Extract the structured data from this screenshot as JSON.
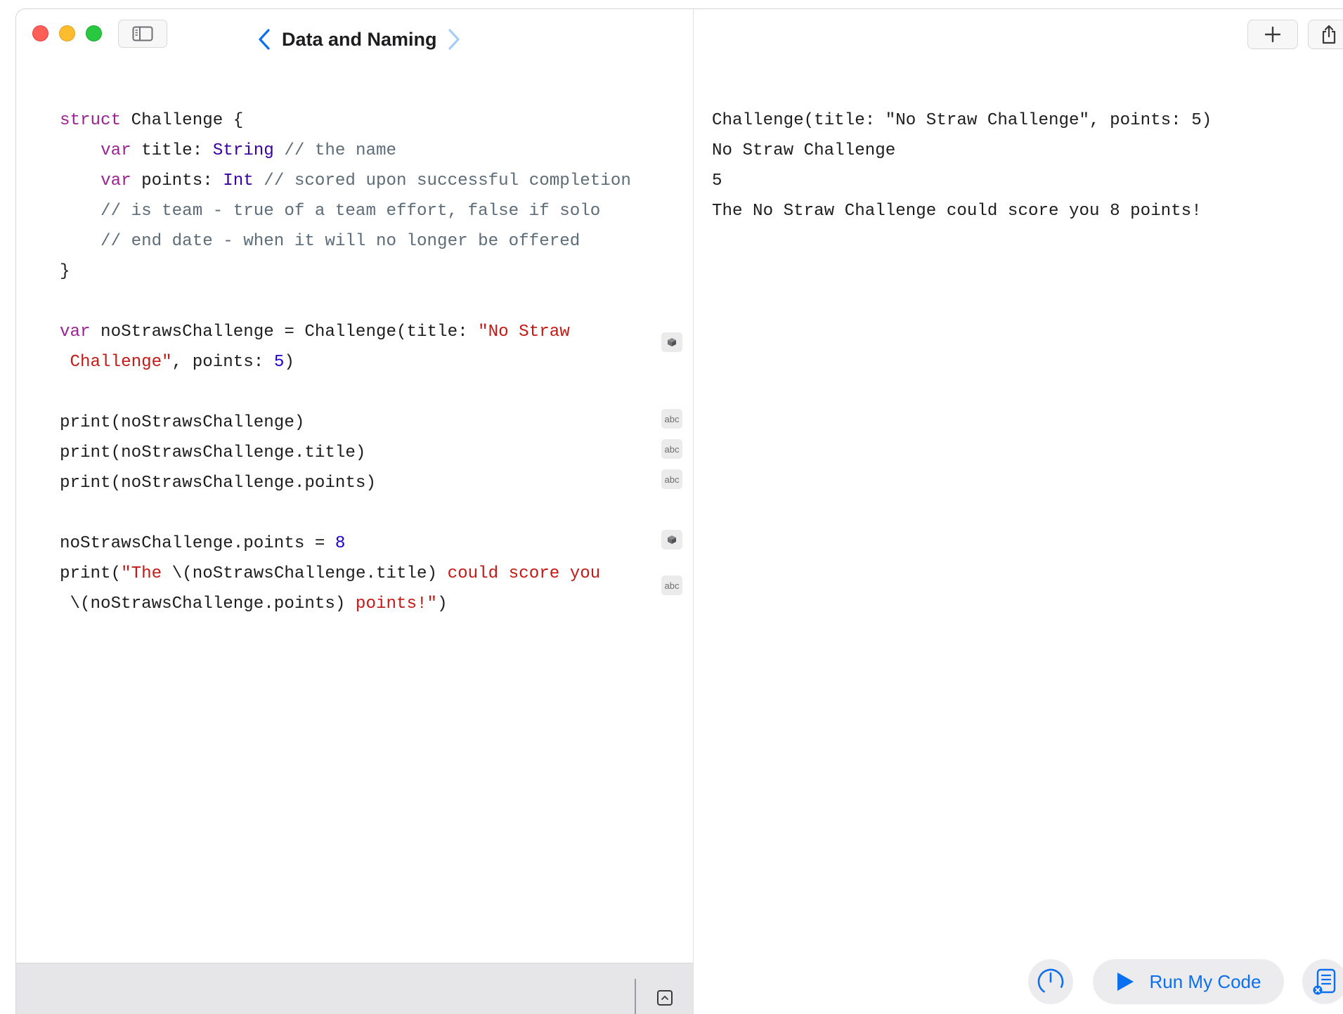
{
  "window": {
    "title": "Data and Naming"
  },
  "icons": {
    "close": "close-icon",
    "minimize": "minimize-icon",
    "zoom": "zoom-icon",
    "sidebar": "sidebar-toggle-icon",
    "back": "chevron-left-icon",
    "forward": "chevron-right-icon",
    "add": "plus-icon",
    "share": "share-icon",
    "speed": "speed-gauge-icon",
    "run": "play-icon",
    "log": "results-log-icon",
    "expand": "chevron-up-icon",
    "cube": "cube-icon"
  },
  "colors": {
    "keyword": "#9b2393",
    "type": "#3900a0",
    "comment": "#5d6c79",
    "string": "#c41a16",
    "number": "#1c00cf",
    "accent": "#0a6ff0"
  },
  "editor": {
    "l1": {
      "kw": "struct",
      "rest": " Challenge {"
    },
    "l2": {
      "indent": "    ",
      "kw": "var",
      "mid": " title: ",
      "type": "String",
      "cmt": " // the name"
    },
    "l3": {
      "indent": "    ",
      "kw": "var",
      "mid": " points: ",
      "type": "Int",
      "cmt": " // scored upon successful completion"
    },
    "l4": {
      "cmt": "    // is team - true of a team effort, false if solo"
    },
    "l5": {
      "cmt": "    // end date - when it will no longer be offered"
    },
    "l6": {
      "text": "}"
    },
    "l8": {
      "kw": "var",
      "mid": " noStrawsChallenge = Challenge(title: ",
      "str": "\"No Straw"
    },
    "l9": {
      "str": " Challenge\"",
      "mid": ", points: ",
      "num": "5",
      "end": ")"
    },
    "l11": {
      "text": "print(noStrawsChallenge)"
    },
    "l12": {
      "text": "print(noStrawsChallenge.title)"
    },
    "l13": {
      "text": "print(noStrawsChallenge.points)"
    },
    "l15": {
      "mid": "noStrawsChallenge.points = ",
      "num": "8"
    },
    "l16": {
      "pre": "print(",
      "str1": "\"The ",
      "mid": "\\(noStrawsChallenge.title)",
      "str2": " could score you"
    },
    "l17": {
      "mid": " \\(noStrawsChallenge.points)",
      "str": " points!\"",
      "end": ")"
    }
  },
  "badges": {
    "abc": "abc"
  },
  "console": {
    "lines": [
      "Challenge(title: \"No Straw Challenge\", points: 5)",
      "No Straw Challenge",
      "5",
      "The No Straw Challenge could score you 8 points!"
    ]
  },
  "toolbar": {
    "run_label": "Run My Code"
  }
}
